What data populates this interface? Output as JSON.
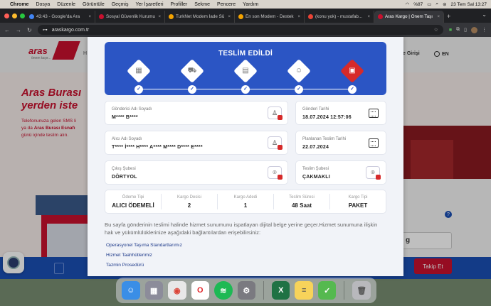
{
  "menubar": {
    "app": "Chrome",
    "items": [
      "Dosya",
      "Düzenle",
      "Görüntüle",
      "Geçmiş",
      "Yer İşaretleri",
      "Profiller",
      "Sekme",
      "Pencere",
      "Yardım"
    ],
    "battery": "%87",
    "datetime": "23 Tem Sal 13:27"
  },
  "tabs": [
    {
      "title": "43:43 - Google'da Ara",
      "color": "#4285f4"
    },
    {
      "title": "Sosyal Güvenlik Kurumu",
      "color": "#c8102e"
    },
    {
      "title": "TurkNet Modem İade Sü",
      "color": "#f4a300"
    },
    {
      "title": "En son Modem - Destek",
      "color": "#f4a300"
    },
    {
      "title": "(konu yok) - mustafab...",
      "color": "#ea4335"
    },
    {
      "title": "Aras Kargo | Önem Taşı",
      "color": "#c8102e"
    }
  ],
  "address": {
    "url": "araskargo.com.tr"
  },
  "site": {
    "logo": "aras",
    "logo_tag": "önem taşır...",
    "nav_first": "H",
    "login": "e Girişi",
    "lang": "EN",
    "hero_title_1": "Aras Burası",
    "hero_title_2": "yerden iste",
    "hero_text_1": "Telefonunuza gelen SMS li",
    "hero_text_2_pre": "ya da ",
    "hero_text_2_bold": "Aras Burası Esnafı",
    "hero_text_3": "günü içinde teslim alın.",
    "search_value": "g",
    "help": "?",
    "track_button": "Takip Et"
  },
  "modal": {
    "status_title": "TESLİM EDİLDİ",
    "steps": [
      {
        "icon": "package-icon",
        "glyph": "▦",
        "check": "✓"
      },
      {
        "icon": "forklift-icon",
        "glyph": "⛟",
        "check": "✓"
      },
      {
        "icon": "warehouse-icon",
        "glyph": "▤",
        "check": "✓"
      },
      {
        "icon": "courier-icon",
        "glyph": "☺",
        "check": "✓"
      },
      {
        "icon": "delivered-box-icon",
        "glyph": "▣",
        "check": "✓"
      }
    ],
    "sender_label": "Gönderici Adı Soyadı",
    "sender_value": "M**** B****",
    "send_date_label": "Gönderi Tarihi",
    "send_date_value": "18.07.2024 12:57:06",
    "receiver_label": "Alıcı Adı Soyadı",
    "receiver_value": "T**** İ**** H**** A**** M**** D**** E****",
    "planned_label": "Planlanan Teslim Tarihi",
    "planned_value": "22.07.2024",
    "origin_label": "Çıkış Şubesi",
    "origin_value": "DÖRTYOL",
    "dest_label": "Teslim Şubesi",
    "dest_value": "ÇAKMAKLI",
    "stats": [
      {
        "label": "Ödeme Tipi",
        "value": "ALICI ÖDEMELİ"
      },
      {
        "label": "Kargo Desisi",
        "value": "2"
      },
      {
        "label": "Kargo Adedi",
        "value": "1"
      },
      {
        "label": "Teslim Süresi",
        "value": "48 Saat"
      },
      {
        "label": "Kargo Tipi",
        "value": "PAKET"
      }
    ],
    "info_text": "Bu sayfa gönderinin teslimi halinde hizmet sunumunu ispatlayan dijital belge yerine geçer.Hizmet sunumuna ilişkin hak ve yükümlülüklerinize aşağıdaki bağlantılardan erişebilirsiniz:",
    "links": [
      "Operasyonel Taşıma Standartlarımız",
      "Hizmet Taahhütlerimiz",
      "Tazmin Prosedürü"
    ]
  },
  "dock": [
    {
      "name": "finder-icon",
      "color": "#3a8ee6",
      "glyph": "☺"
    },
    {
      "name": "launchpad-icon",
      "color": "#8c8c9a",
      "glyph": "▦"
    },
    {
      "name": "chrome-icon",
      "color": "#e8e8e8",
      "glyph": "◉"
    },
    {
      "name": "opera-icon",
      "color": "#ffffff",
      "glyph": "O"
    },
    {
      "name": "spotify-icon",
      "color": "#1db954",
      "glyph": "≋"
    },
    {
      "name": "system-settings-icon",
      "color": "#7a7a80",
      "glyph": "⚙"
    },
    {
      "name": "excel-icon",
      "color": "#1f7244",
      "glyph": "X"
    },
    {
      "name": "notes-icon",
      "color": "#f7d35a",
      "glyph": "≡"
    },
    {
      "name": "security-icon",
      "color": "#55b94f",
      "glyph": "✓"
    },
    {
      "name": "trash-icon",
      "color": "#b8b8bc",
      "glyph": "🗑"
    }
  ],
  "colors": {
    "accent": "#2b55c4",
    "brand": "#c8102e"
  }
}
